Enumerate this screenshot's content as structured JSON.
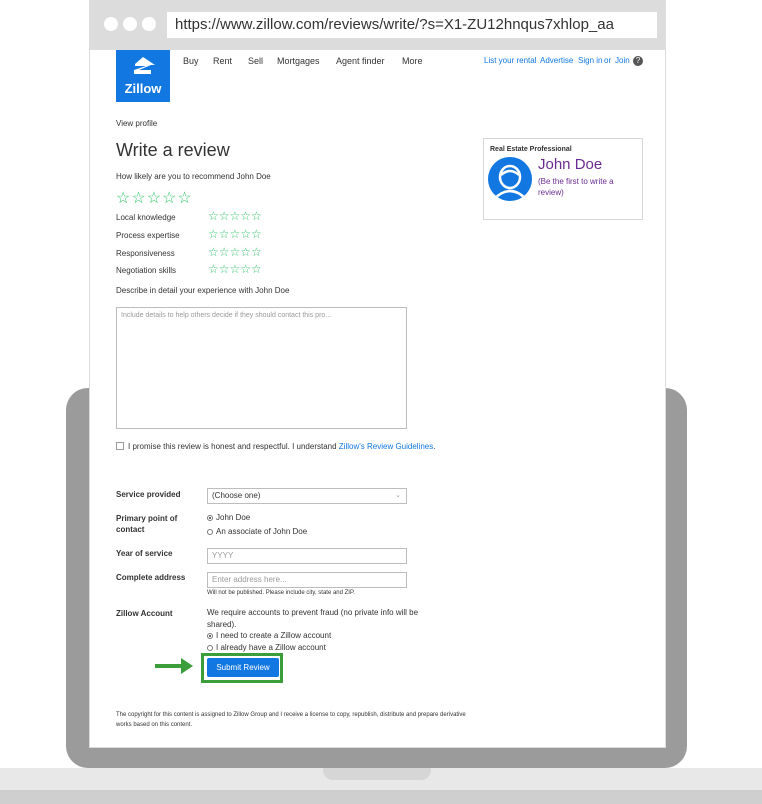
{
  "browser": {
    "url": "https://www.zillow.com/reviews/write/?s=X1-ZU12hnqus7xhlop_aa"
  },
  "header": {
    "logo_text": "Zillow",
    "nav": [
      "Buy",
      "Rent",
      "Sell",
      "Mortgages",
      "Agent finder",
      "More"
    ],
    "list_rental": "List your rental",
    "advertise": "Advertise",
    "sign_in": "Sign in",
    "or": "or",
    "join": "Join",
    "help": "?"
  },
  "page": {
    "view_profile": "View profile",
    "title": "Write a review",
    "recommend_question": "How likely are you to recommend John Doe",
    "stars": "☆☆☆☆☆",
    "categories": [
      "Local knowledge",
      "Process expertise",
      "Responsiveness",
      "Negotiation skills"
    ],
    "describe_label": "Describe in detail your experience with John Doe",
    "textarea_placeholder": "Include details to help others decide if they should contact this pro..."
  },
  "agent_card": {
    "label": "Real Estate Professional",
    "name": "John Doe",
    "subtitle": "(Be the first to write a review)"
  },
  "promise": {
    "text": "I promise this review is honest and respectful. I understand",
    "link": "Zillow's Review Guidelines",
    "end": "."
  },
  "form": {
    "service_label": "Service provided",
    "service_value": "(Choose one)",
    "contact_label": "Primary point of contact",
    "contact_options": [
      "John Doe",
      "An associate of John Doe"
    ],
    "year_label": "Year of service",
    "year_placeholder": "YYYY",
    "address_label": "Complete address",
    "address_placeholder": "Enter address here...",
    "address_note": "Will not be published. Please include city, state and ZIP.",
    "account_label": "Zillow Account",
    "account_text": "We require accounts to prevent fraud (no private info will be shared).",
    "account_options": [
      "I need to create a Zillow account",
      "I already have a Zillow account"
    ],
    "submit_label": "Submit Review"
  },
  "footer": {
    "text": "The copyright for this content is assigned to Zillow Group and I receive a license to copy, republish, distribute and prepare derivative works based on this content."
  },
  "colors": {
    "brand_blue": "#1277e1",
    "star_green": "#35c36b",
    "highlight_green": "#3b9e3b",
    "agent_purple": "#6b2c91"
  }
}
